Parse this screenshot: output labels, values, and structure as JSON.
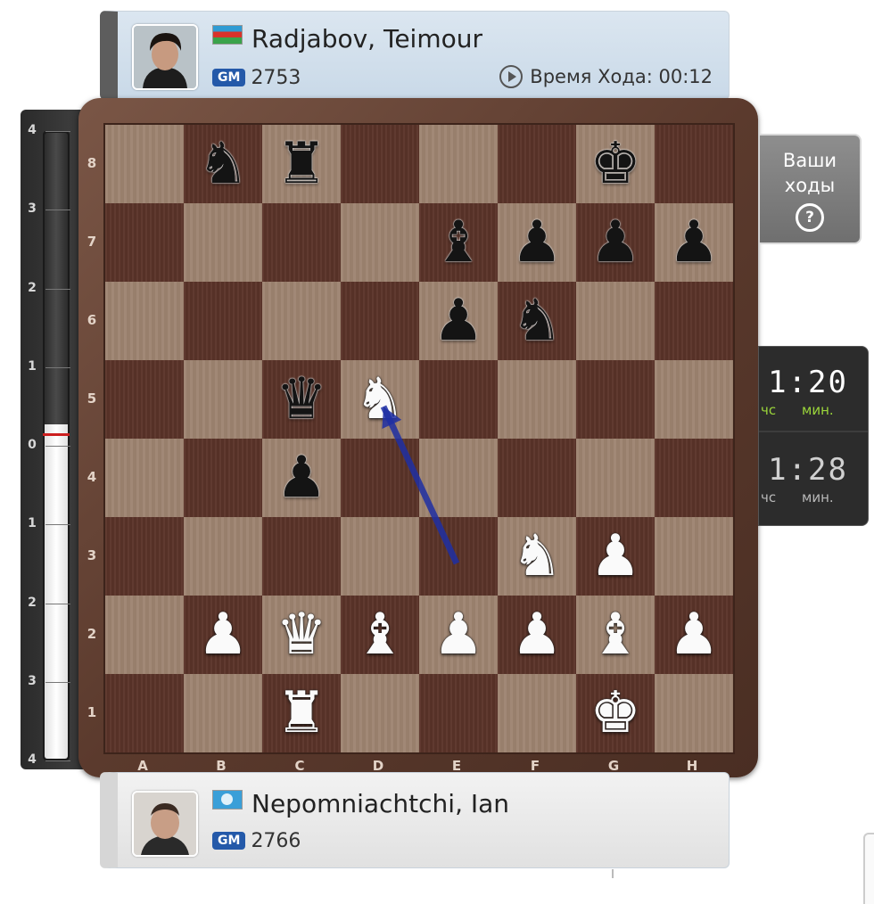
{
  "top_player": {
    "name": "Radjabov, Teimour",
    "title": "GM",
    "rating": "2753",
    "move_time_label": "Время Хода: 00:12",
    "flag": "azerbaijan-flag"
  },
  "bottom_player": {
    "name": "Nepomniachtchi, Ian",
    "title": "GM",
    "rating": "2766",
    "flag": "fide-flag"
  },
  "eval_bar": {
    "labels_top_to_bottom": [
      "4",
      "3",
      "2",
      "1",
      "0",
      "1",
      "2",
      "3",
      "4"
    ],
    "evaluation": 0
  },
  "board": {
    "ranks": [
      "8",
      "7",
      "6",
      "5",
      "4",
      "3",
      "2",
      "1"
    ],
    "files": [
      "A",
      "B",
      "C",
      "D",
      "E",
      "F",
      "G",
      "H"
    ],
    "pieces": [
      {
        "square": "b8",
        "color": "black",
        "type": "knight"
      },
      {
        "square": "c8",
        "color": "black",
        "type": "rook"
      },
      {
        "square": "g8",
        "color": "black",
        "type": "king"
      },
      {
        "square": "e7",
        "color": "black",
        "type": "bishop"
      },
      {
        "square": "f7",
        "color": "black",
        "type": "pawn"
      },
      {
        "square": "g7",
        "color": "black",
        "type": "pawn"
      },
      {
        "square": "h7",
        "color": "black",
        "type": "pawn"
      },
      {
        "square": "e6",
        "color": "black",
        "type": "pawn"
      },
      {
        "square": "f6",
        "color": "black",
        "type": "knight"
      },
      {
        "square": "c5",
        "color": "black",
        "type": "queen"
      },
      {
        "square": "d5",
        "color": "white",
        "type": "knight"
      },
      {
        "square": "c4",
        "color": "black",
        "type": "pawn"
      },
      {
        "square": "f3",
        "color": "white",
        "type": "knight"
      },
      {
        "square": "g3",
        "color": "white",
        "type": "pawn"
      },
      {
        "square": "b2",
        "color": "white",
        "type": "pawn"
      },
      {
        "square": "c2",
        "color": "white",
        "type": "queen"
      },
      {
        "square": "d2",
        "color": "white",
        "type": "bishop"
      },
      {
        "square": "e2",
        "color": "white",
        "type": "pawn"
      },
      {
        "square": "f2",
        "color": "white",
        "type": "pawn"
      },
      {
        "square": "g2",
        "color": "white",
        "type": "bishop"
      },
      {
        "square": "h2",
        "color": "white",
        "type": "pawn"
      },
      {
        "square": "c1",
        "color": "white",
        "type": "rook"
      },
      {
        "square": "g1",
        "color": "white",
        "type": "king"
      }
    ],
    "last_move_arrow": {
      "from": "e3",
      "to": "d5",
      "color": "#1f2fa3"
    }
  },
  "your_moves": {
    "label_line1": "Ваши",
    "label_line2": "ходы",
    "help_glyph": "?"
  },
  "clocks": {
    "top": {
      "time": "1:20",
      "hours_unit": "чс",
      "minutes_unit": "мин.",
      "active": true,
      "unit_color": "#9bd63a"
    },
    "bottom": {
      "time": "1:28",
      "hours_unit": "чс",
      "minutes_unit": "мин.",
      "active": false,
      "unit_color": "#b8b8b8"
    }
  },
  "colors": {
    "light_square": "#9d8370",
    "dark_square": "#5b3429",
    "gm_badge": "#2459a9"
  }
}
